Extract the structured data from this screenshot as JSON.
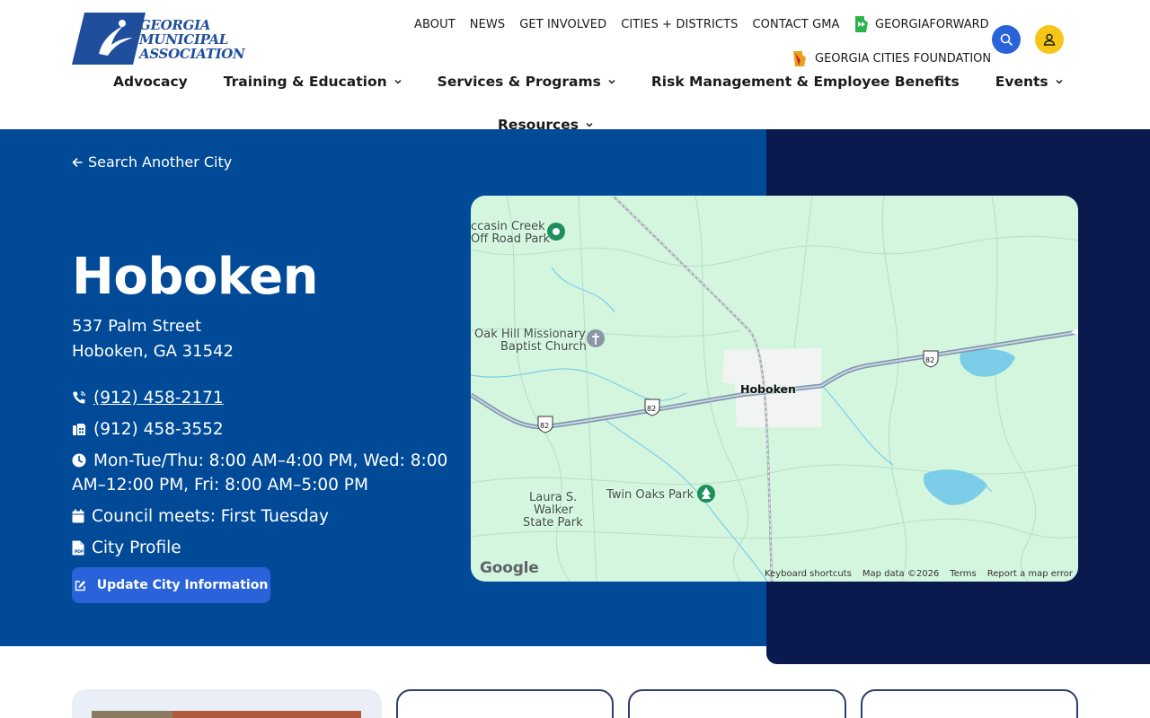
{
  "logo": {
    "line1": "GEORGIA",
    "line2": "MUNICIPAL",
    "line3": "ASSOCIATION"
  },
  "util_nav": [
    "ABOUT",
    "NEWS",
    "GET INVOLVED",
    "CITIES + DISTRICTS",
    "CONTACT GMA"
  ],
  "georgia_forward": "GEORGIAFORWARD",
  "georgia_cities_foundation": "GEORGIA CITIES FOUNDATION",
  "main_nav": [
    {
      "label": "Advocacy",
      "dropdown": false
    },
    {
      "label": "Training & Education",
      "dropdown": true
    },
    {
      "label": "Services & Programs",
      "dropdown": true
    },
    {
      "label": "Risk Management & Employee Benefits",
      "dropdown": false
    },
    {
      "label": "Events",
      "dropdown": true
    }
  ],
  "resources": "Resources",
  "back_link": "Search Another City",
  "city": {
    "name": "Hoboken",
    "address_line1": "537 Palm Street",
    "address_line2": "Hoboken, GA 31542",
    "phone": "(912) 458-2171",
    "fax": "(912) 458-3552",
    "hours": "Mon-Tue/Thu: 8:00 AM–4:00 PM, Wed: 8:00 AM–12:00 PM, Fri: 8:00 AM–5:00 PM",
    "council": "Council meets: First Tuesday",
    "profile": "City Profile"
  },
  "update_button": "Update City Information",
  "map": {
    "labels": {
      "moccasin_1": "ccasin Creek",
      "moccasin_2": "Off Road Park",
      "oakhill_1": "Oak Hill Missionary",
      "oakhill_2": "Baptist Church",
      "hoboken": "Hoboken",
      "twin_oaks": "Twin Oaks Park",
      "laura_1": "Laura S.",
      "laura_2": "Walker",
      "laura_3": "State Park"
    },
    "route": "82",
    "google": "Google",
    "attribution": [
      "Keyboard shortcuts",
      "Map data ©2026",
      "Terms",
      "Report a map error"
    ]
  },
  "colors": {
    "hero_blue": "#004a98",
    "hero_navy": "#0a1a4f",
    "accent_blue": "#2a63d9",
    "user_yellow": "#f5c518",
    "map_green": "#d4f6df"
  }
}
